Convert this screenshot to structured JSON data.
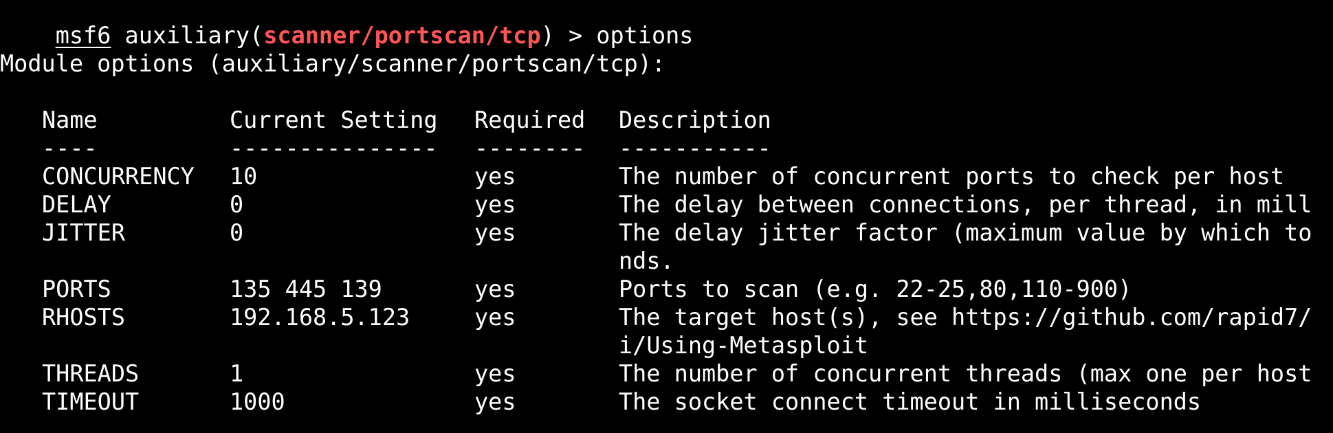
{
  "prompt": {
    "prefix": "msf6",
    "module_open": " auxiliary(",
    "module_name": "scanner/portscan/tcp",
    "module_close": ") > ",
    "command": "options"
  },
  "section_title": "Module options (auxiliary/scanner/portscan/tcp):",
  "table": {
    "headers": {
      "name": "Name",
      "setting": "Current Setting",
      "required": "Required",
      "description": "Description"
    },
    "rules": {
      "name": "----",
      "setting": "---------------",
      "required": "--------",
      "description": "-----------"
    },
    "rows": [
      {
        "name": "CONCURRENCY",
        "setting": "10",
        "required": "yes",
        "description": "The number of concurrent ports to check per host"
      },
      {
        "name": "DELAY",
        "setting": "0",
        "required": "yes",
        "description": "The delay between connections, per thread, in mill"
      },
      {
        "name": "JITTER",
        "setting": "0",
        "required": "yes",
        "description": "The delay jitter factor (maximum value by which to",
        "description_cont": "nds."
      },
      {
        "name": "PORTS",
        "setting": "135 445 139",
        "required": "yes",
        "description": "Ports to scan (e.g. 22-25,80,110-900)"
      },
      {
        "name": "RHOSTS",
        "setting": "192.168.5.123",
        "required": "yes",
        "description": "The target host(s), see https://github.com/rapid7/",
        "description_cont": "i/Using-Metasploit"
      },
      {
        "name": "THREADS",
        "setting": "1",
        "required": "yes",
        "description": "The number of concurrent threads (max one per host"
      },
      {
        "name": "TIMEOUT",
        "setting": "1000",
        "required": "yes",
        "description": "The socket connect timeout in milliseconds"
      }
    ]
  },
  "colors": {
    "background": "#000000",
    "text": "#ffffff",
    "module_highlight": "#ff5555"
  }
}
